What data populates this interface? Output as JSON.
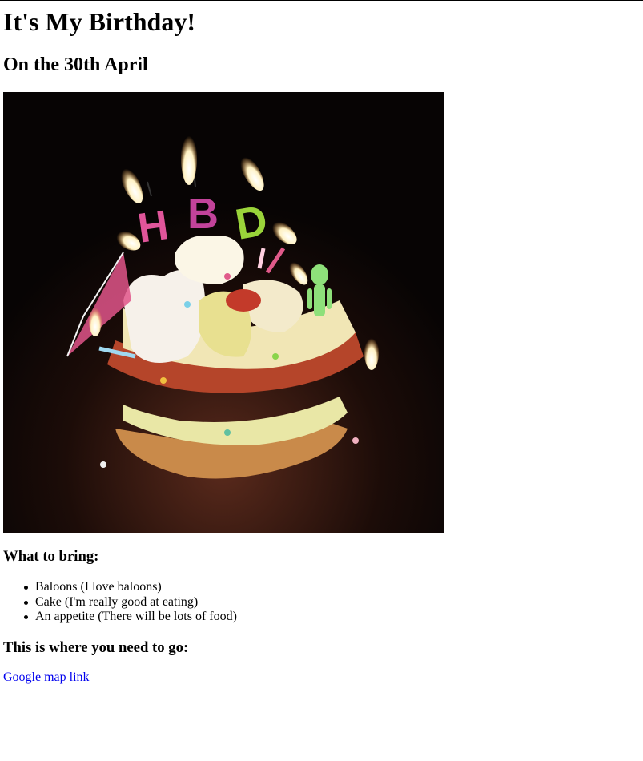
{
  "page": {
    "title": "It's My Birthday!",
    "subtitle": "On the 30th April"
  },
  "image": {
    "icon": "birthday-cake-image",
    "candle_letters": [
      "H",
      "B",
      "D"
    ],
    "colors": {
      "background": "#0a0606",
      "letter_h": "#e0559a",
      "letter_b": "#c2439a",
      "letter_d": "#9ad43a",
      "flame": "#fff5d0"
    }
  },
  "bring": {
    "title": "What to bring:",
    "items": [
      "Baloons (I love baloons)",
      "Cake (I'm really good at eating)",
      "An appetite (There will be lots of food)"
    ]
  },
  "directions": {
    "title": "This is where you need to go:",
    "link_label": "Google map link",
    "link_color": "#0000ee"
  }
}
